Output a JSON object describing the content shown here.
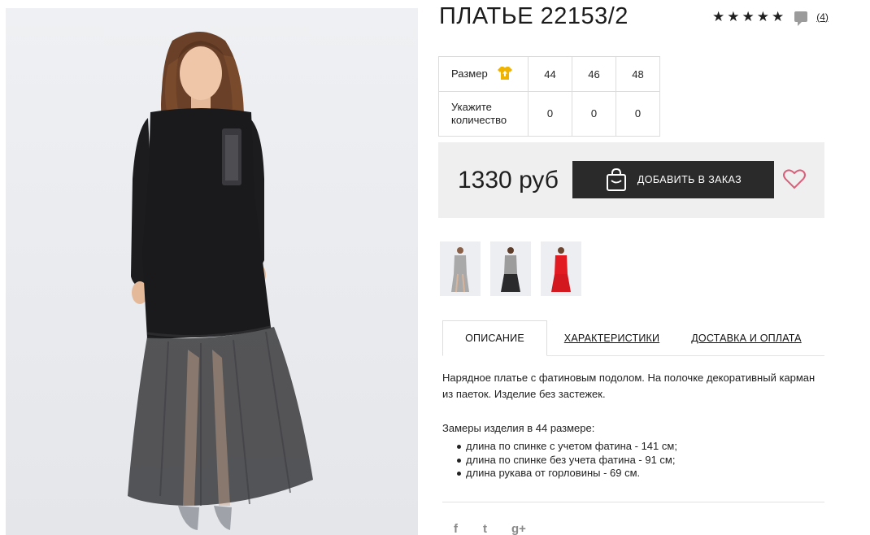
{
  "product": {
    "title": "ПЛАТЬЕ 22153/2",
    "rating_stars": 5,
    "review_count": "(4)"
  },
  "size_table": {
    "size_label": "Размер",
    "qty_label_line1": "Укажите",
    "qty_label_line2": "количество",
    "sizes": [
      "44",
      "46",
      "48"
    ],
    "quantities": [
      "0",
      "0",
      "0"
    ]
  },
  "purchase": {
    "price": "1330 руб",
    "add_button_label": "ДОБАВИТЬ В ЗАКАЗ"
  },
  "thumbnails": [
    {
      "dress_color": "#a9a9a9"
    },
    {
      "dress_color": "#9c9c9c"
    },
    {
      "dress_color": "#e21a22"
    }
  ],
  "tabs": [
    {
      "label": "ОПИСАНИЕ"
    },
    {
      "label": "ХАРАКТЕРИСТИКИ"
    },
    {
      "label": "ДОСТАВКА И ОПЛАТА"
    }
  ],
  "description": {
    "text": "Нарядное платье с фатиновым подолом. На полочке декоративный карман из паеток. Изделие без застежек.",
    "measure_title": "Замеры изделия в 44 размере:",
    "measures": [
      "длина по спинке с учетом фатина - 141 см;",
      "длина по спинке без учета фатина - 91 см;",
      "длина рукава от горловины - 69 см."
    ]
  },
  "social": {
    "facebook": "f",
    "twitter": "t",
    "googleplus": "g+"
  },
  "colors": {
    "accent_dark": "#2a2a2a",
    "wishlist_heart": "#d9607a",
    "size_icon": "#f0b400",
    "price_box_bg": "#efefef"
  }
}
